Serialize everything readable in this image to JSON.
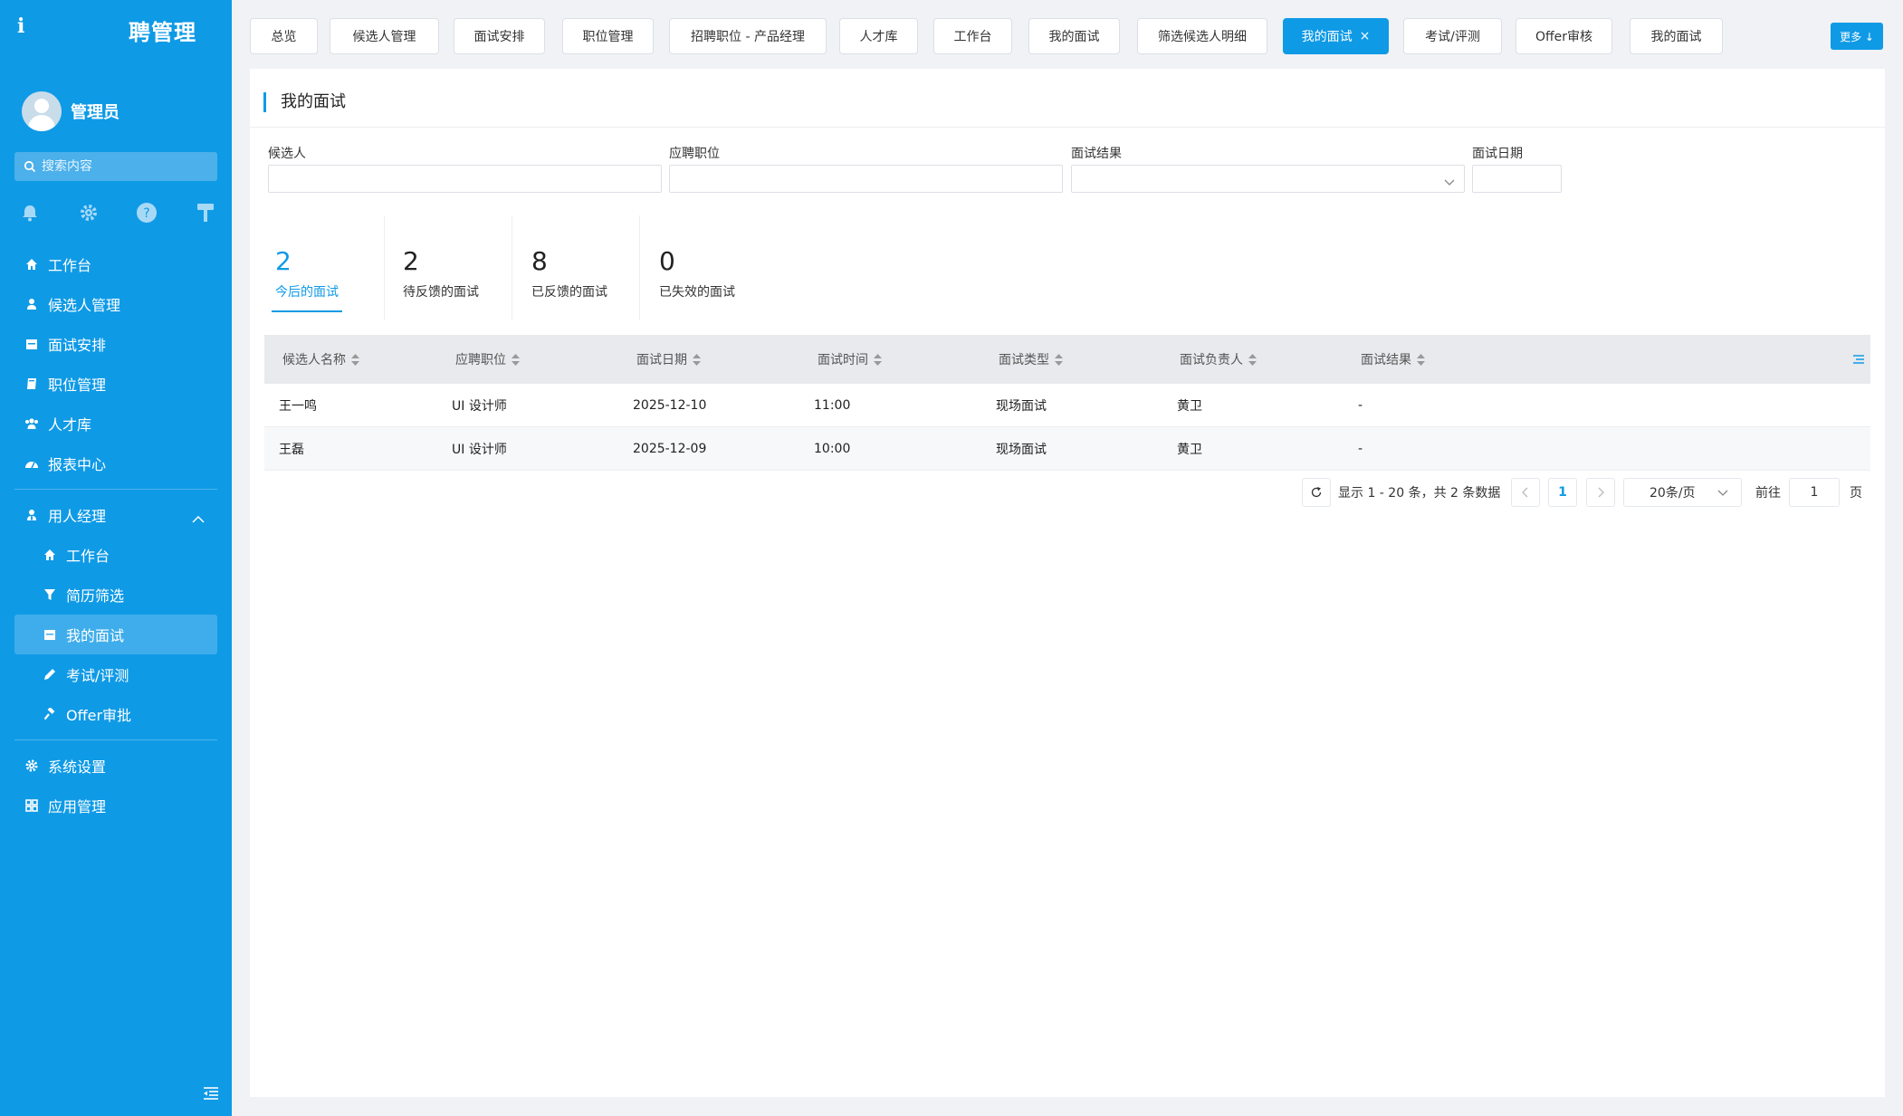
{
  "sidebar": {
    "brand_initial": "i",
    "brand_title": "聘管理",
    "username": "管理员",
    "search_placeholder": "搜索内容",
    "menu": [
      {
        "label": "工作台"
      },
      {
        "label": "候选人管理"
      },
      {
        "label": "面试安排"
      },
      {
        "label": "职位管理"
      },
      {
        "label": "人才库"
      },
      {
        "label": "报表中心"
      }
    ],
    "group": {
      "label": "用人经理",
      "items": [
        {
          "label": "工作台"
        },
        {
          "label": "简历筛选"
        },
        {
          "label": "我的面试"
        },
        {
          "label": "考试/评测"
        },
        {
          "label": "Offer审批"
        }
      ]
    },
    "bottom": [
      {
        "label": "系统设置"
      },
      {
        "label": "应用管理"
      }
    ]
  },
  "tabs": [
    {
      "label": "总览"
    },
    {
      "label": "候选人管理"
    },
    {
      "label": "面试安排"
    },
    {
      "label": "职位管理"
    },
    {
      "label": "招聘职位 - 产品经理"
    },
    {
      "label": "人才库"
    },
    {
      "label": "工作台"
    },
    {
      "label": "我的面试"
    },
    {
      "label": "筛选候选人明细"
    },
    {
      "label": "我的面试"
    },
    {
      "label": "考试/评测"
    },
    {
      "label": "Offer审核"
    },
    {
      "label": "我的面试"
    }
  ],
  "more_button": "更多 ↓",
  "page_title": "我的面试",
  "filters": {
    "candidate": "候选人",
    "position": "应聘职位",
    "result": "面试结果",
    "date": "面试日期"
  },
  "stats": [
    {
      "value": "2",
      "label": "今后的面试"
    },
    {
      "value": "2",
      "label": "待反馈的面试"
    },
    {
      "value": "8",
      "label": "已反馈的面试"
    },
    {
      "value": "0",
      "label": "已失效的面试"
    }
  ],
  "table": {
    "columns": [
      "候选人名称",
      "应聘职位",
      "面试日期",
      "面试时间",
      "面试类型",
      "面试负责人",
      "面试结果"
    ],
    "rows": [
      [
        "王一鸣",
        "UI 设计师",
        "2025-12-10",
        "11:00",
        "现场面试",
        "黄卫",
        "-"
      ],
      [
        "王磊",
        "UI 设计师",
        "2025-12-09",
        "10:00",
        "现场面试",
        "黄卫",
        "-"
      ]
    ]
  },
  "pagination": {
    "summary": "显示 1 - 20 条，共 2 条数据",
    "current_page": "1",
    "page_size": "20条/页",
    "goto_prefix": "前往",
    "goto_value": "1",
    "goto_suffix": "页"
  },
  "colors": {
    "accent": "#0f9ae6",
    "sidebar_bg": "#0f9ae6",
    "active_sub": "#3fadeb"
  }
}
